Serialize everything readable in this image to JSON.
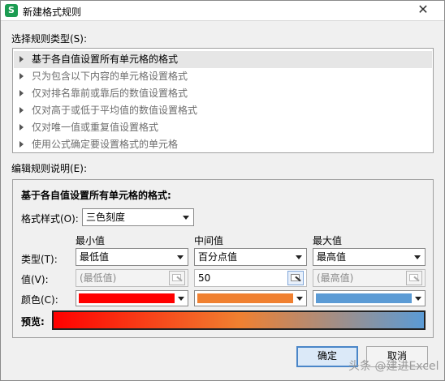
{
  "window": {
    "title": "新建格式规则",
    "app_icon_letter": "S",
    "close_glyph": "✕"
  },
  "rule_type": {
    "label": "选择规则类型(S):",
    "items": [
      {
        "label": "基于各自值设置所有单元格的格式",
        "selected": true
      },
      {
        "label": "只为包含以下内容的单元格设置格式",
        "selected": false
      },
      {
        "label": "仅对排名靠前或靠后的数值设置格式",
        "selected": false
      },
      {
        "label": "仅对高于或低于平均值的数值设置格式",
        "selected": false
      },
      {
        "label": "仅对唯一值或重复值设置格式",
        "selected": false
      },
      {
        "label": "使用公式确定要设置格式的单元格",
        "selected": false
      }
    ]
  },
  "edit": {
    "label": "编辑规则说明(E):",
    "heading": "基于各自值设置所有单元格的格式:",
    "format_style_label": "格式样式(O):",
    "format_style_value": "三色刻度",
    "col_min": "最小值",
    "col_mid": "中间值",
    "col_max": "最大值",
    "type_label": "类型(T):",
    "value_label": "值(V):",
    "color_label": "颜色(C):",
    "preview_label": "预览:",
    "min": {
      "type": "最低值",
      "value": "(最低值)",
      "color": "#ff0000"
    },
    "mid": {
      "type": "百分点值",
      "value": "50",
      "color": "#f08030"
    },
    "max": {
      "type": "最高值",
      "value": "(最高值)",
      "color": "#5b9bd5"
    }
  },
  "buttons": {
    "ok": "确定",
    "cancel": "取消"
  },
  "watermark": "头条 @建进Excel"
}
